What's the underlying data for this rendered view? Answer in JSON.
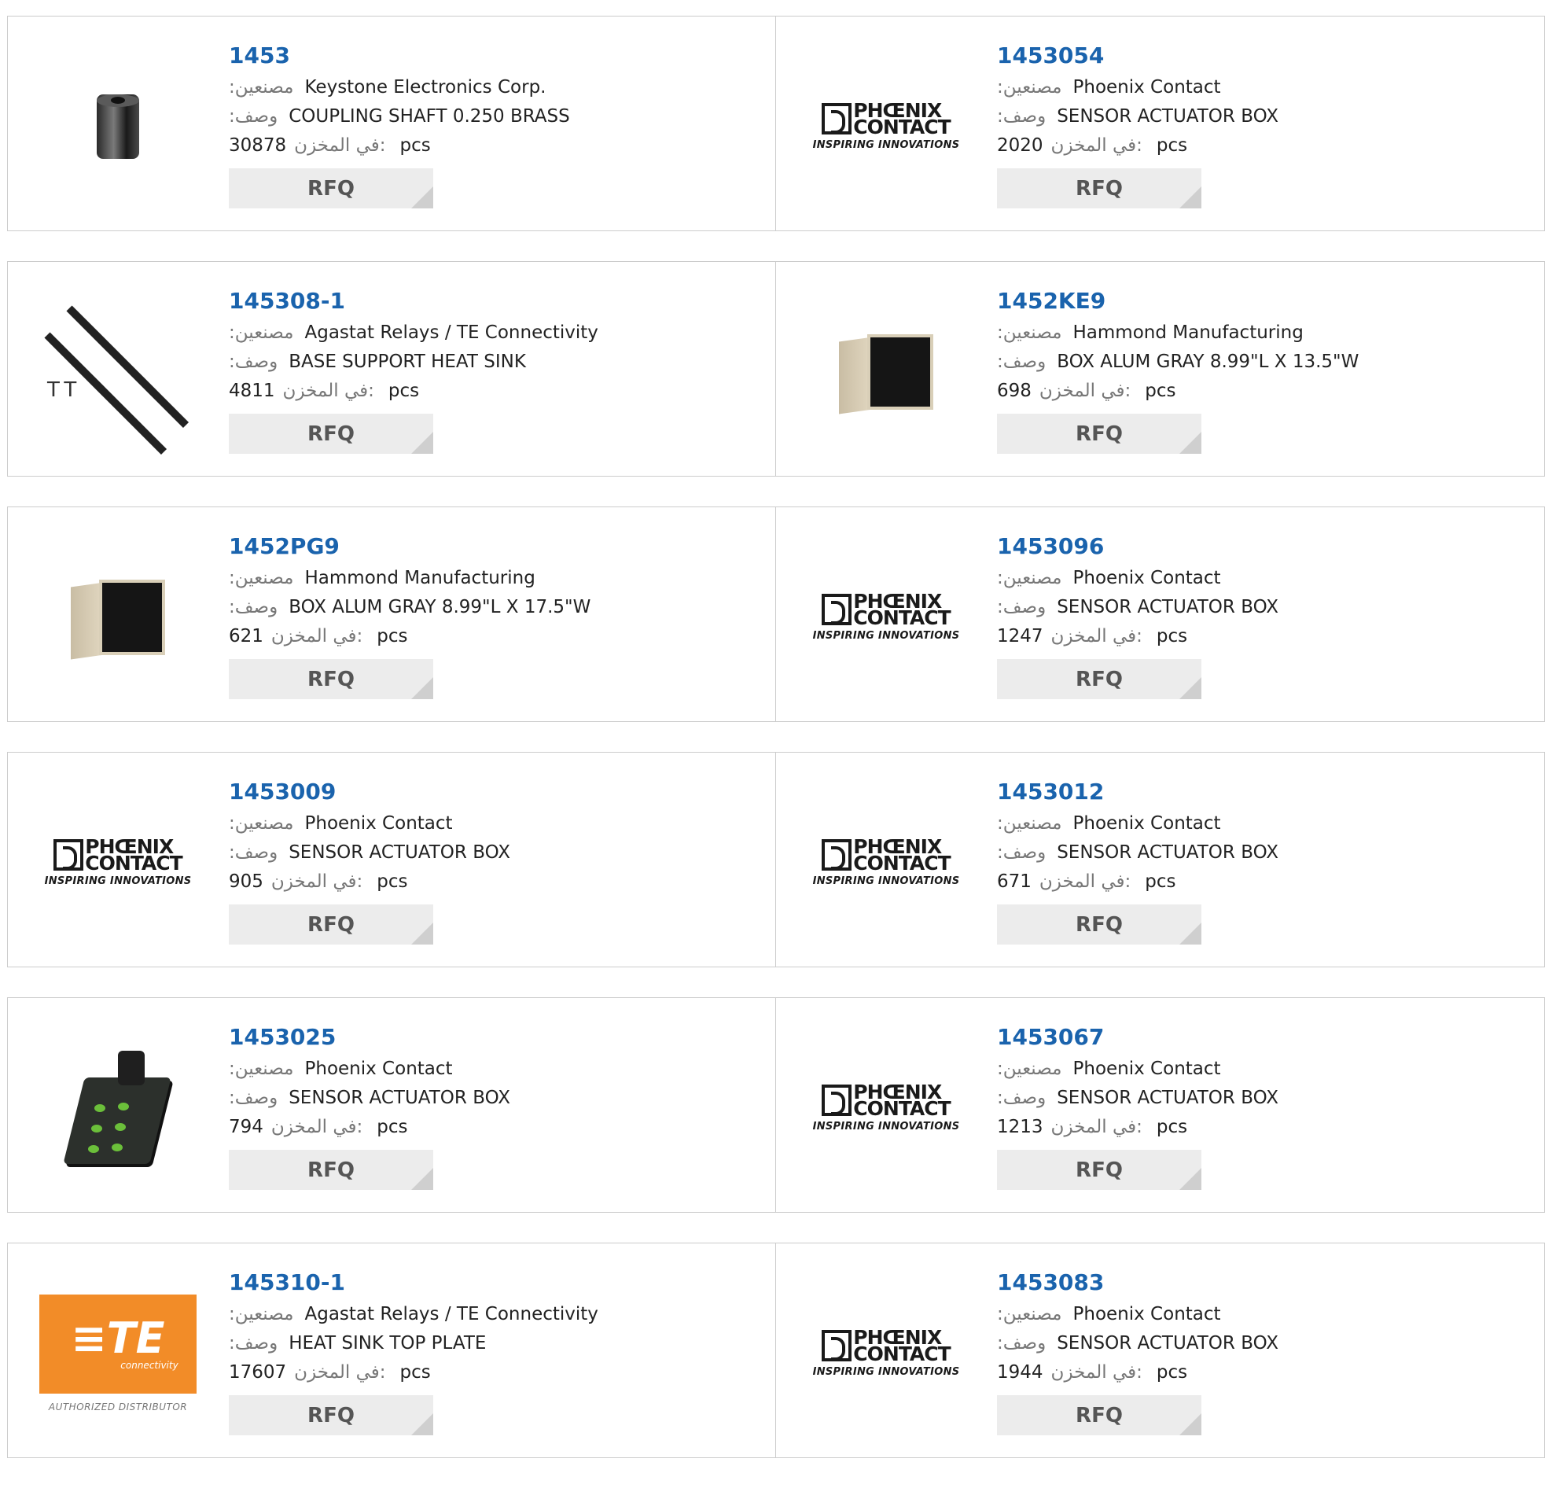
{
  "labels": {
    "manufacturer": ":مصنعين",
    "description": ":وصف",
    "stock": "في المخزن:",
    "unit": "pcs",
    "rfq": "RFQ"
  },
  "products": [
    {
      "part": "1453",
      "manufacturer": "Keystone Electronics Corp.",
      "description": "COUPLING SHAFT 0.250 BRASS",
      "stock": "30878",
      "image": "coupling-image"
    },
    {
      "part": "1453054",
      "manufacturer": "Phoenix Contact",
      "description": "SENSOR ACTUATOR BOX",
      "stock": "2020",
      "image": "phoenix-contact-logo"
    },
    {
      "part": "145308-1",
      "manufacturer": "Agastat Relays / TE Connectivity",
      "description": "BASE SUPPORT HEAT SINK",
      "stock": "4811",
      "image": "heat-sink-image"
    },
    {
      "part": "1452KE9",
      "manufacturer": "Hammond Manufacturing",
      "description": "BOX ALUM GRAY 8.99\"L X 13.5\"W",
      "stock": "698",
      "image": "enclosure-box-image"
    },
    {
      "part": "1452PG9",
      "manufacturer": "Hammond Manufacturing",
      "description": "BOX ALUM GRAY 8.99\"L X 17.5\"W",
      "stock": "621",
      "image": "enclosure-box-image"
    },
    {
      "part": "1453096",
      "manufacturer": "Phoenix Contact",
      "description": "SENSOR ACTUATOR BOX",
      "stock": "1247",
      "image": "phoenix-contact-logo"
    },
    {
      "part": "1453009",
      "manufacturer": "Phoenix Contact",
      "description": "SENSOR ACTUATOR BOX",
      "stock": "905",
      "image": "phoenix-contact-logo"
    },
    {
      "part": "1453012",
      "manufacturer": "Phoenix Contact",
      "description": "SENSOR ACTUATOR BOX",
      "stock": "671",
      "image": "phoenix-contact-logo"
    },
    {
      "part": "1453025",
      "manufacturer": "Phoenix Contact",
      "description": "SENSOR ACTUATOR BOX",
      "stock": "794",
      "image": "sensor-box-image"
    },
    {
      "part": "1453067",
      "manufacturer": "Phoenix Contact",
      "description": "SENSOR ACTUATOR BOX",
      "stock": "1213",
      "image": "phoenix-contact-logo"
    },
    {
      "part": "145310-1",
      "manufacturer": "Agastat Relays / TE Connectivity",
      "description": "HEAT SINK TOP PLATE",
      "stock": "17607",
      "image": "te-connectivity-logo"
    },
    {
      "part": "1453083",
      "manufacturer": "Phoenix Contact",
      "description": "SENSOR ACTUATOR BOX",
      "stock": "1944",
      "image": "phoenix-contact-logo"
    }
  ],
  "logos": {
    "phoenix_line1": "PHŒNIX",
    "phoenix_line2": "CONTACT",
    "phoenix_tagline": "INSPIRING INNOVATIONS",
    "te_main": "≡TE",
    "te_sub": "connectivity",
    "te_authorized": "AUTHORIZED DISTRIBUTOR",
    "heatsink_marks": "TT"
  },
  "colors": {
    "part_number": "#1a63ad",
    "rfq_bg": "#ececec",
    "te_orange": "#f28c28",
    "border": "#cccccc"
  }
}
